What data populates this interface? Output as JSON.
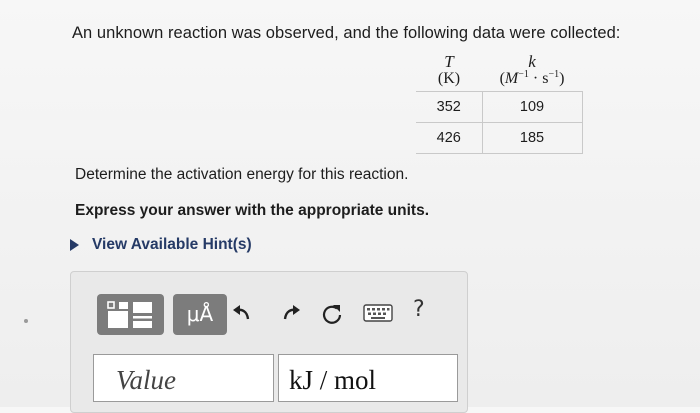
{
  "problem": {
    "intro": "An unknown reaction was observed, and the following data were collected:",
    "question": "Determine the activation energy for this reaction.",
    "instruction": "Express your answer with the appropriate units.",
    "hint_label": "View Available Hint(s)"
  },
  "table": {
    "col_t_symbol": "T",
    "col_t_unit": "(K)",
    "col_k_symbol": "k",
    "rows": [
      {
        "t": "352",
        "k": "109"
      },
      {
        "t": "426",
        "k": "185"
      }
    ]
  },
  "toolbar": {
    "symbols_label": "μÅ",
    "help_label": "?"
  },
  "answer": {
    "value_placeholder": "Value",
    "units_value": "kJ / mol"
  },
  "colors": {
    "hint_link": "#253a66",
    "toolbar_button": "#7c7c7c"
  },
  "icons": [
    "templates-icon",
    "undo-icon",
    "redo-icon",
    "reset-icon",
    "keyboard-icon",
    "help-icon"
  ]
}
